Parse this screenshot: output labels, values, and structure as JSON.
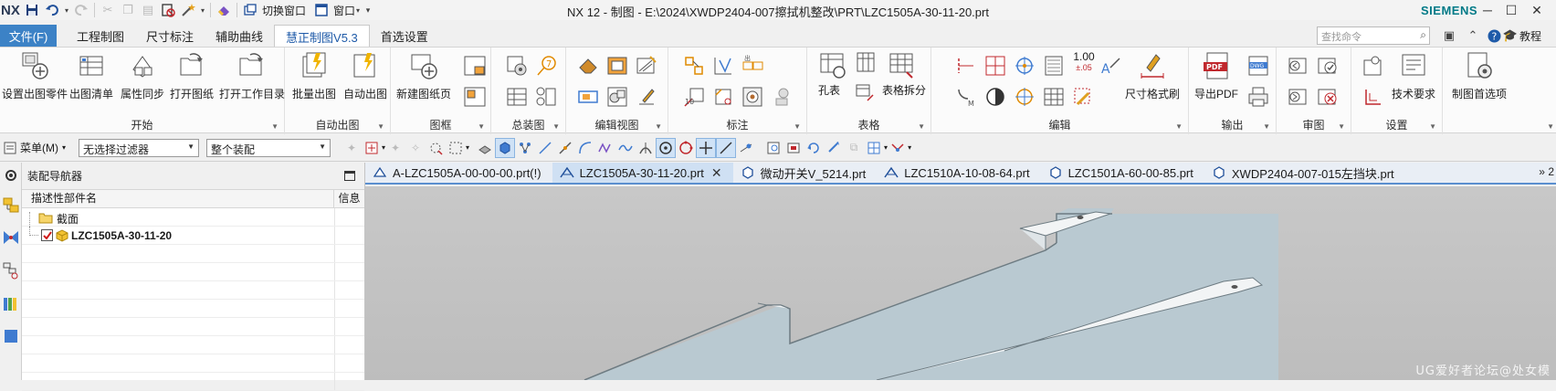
{
  "titlebar": {
    "logo": "NX",
    "quick_access": [
      "save-icon",
      "undo-icon",
      "redo-icon",
      "cut-icon",
      "copy-icon",
      "paste-icon",
      "delete-icon",
      "magic-wand-icon",
      "eraser-icon"
    ],
    "switch_window": "切换窗口",
    "window_menu": "窗口",
    "title": "NX 12 - 制图 - E:\\2024\\XWDP2404-007擦拭机整改\\PRT\\LZC1505A-30-11-20.prt",
    "brand": "SIEMENS"
  },
  "menubar": {
    "file": "文件(F)",
    "tabs": [
      "工程制图",
      "尺寸标注",
      "辅助曲线",
      "慧正制图V5.3",
      "首选设置"
    ],
    "active_tab": "慧正制图V5.3",
    "search_placeholder": "查找命令",
    "tutorial": "教程"
  },
  "ribbon": {
    "groups": {
      "start": {
        "label": "开始",
        "buttons": [
          "设置出图零件",
          "出图清单",
          "属性同步",
          "打开图纸",
          "打开工作目录"
        ]
      },
      "auto": {
        "label": "自动出图",
        "buttons": [
          "批量出图",
          "自动出图"
        ]
      },
      "frame": {
        "label": "图框",
        "buttons": [
          "新建图纸页"
        ]
      },
      "assembly": {
        "label": "总装图"
      },
      "editview": {
        "label": "编辑视图"
      },
      "annotation": {
        "label": "标注"
      },
      "table": {
        "label": "表格",
        "buttons": [
          "孔表",
          "表格拆分"
        ]
      },
      "edit": {
        "label": "编辑",
        "buttons": [
          "尺寸格式刷"
        ],
        "tolerance_text": "1.00",
        "tolerance_sub": "±.05"
      },
      "output": {
        "label": "输出",
        "buttons": [
          "导出PDF"
        ]
      },
      "review": {
        "label": "审图"
      },
      "settings": {
        "label": "设置",
        "buttons": [
          "技术要求"
        ]
      },
      "prefs": {
        "buttons": [
          "制图首选项"
        ]
      }
    }
  },
  "toolrow": {
    "menu": "菜单(M)",
    "filter": "无选择过滤器",
    "scope": "整个装配"
  },
  "navigator": {
    "title": "装配导航器",
    "col_name": "描述性部件名",
    "col_info": "信息",
    "rows": [
      {
        "label": "截面"
      },
      {
        "label": "LZC1505A-30-11-20"
      }
    ]
  },
  "doctabs": [
    {
      "label": "A-LZC1505A-00-00-00.prt(!)",
      "icon": "assembly-icon"
    },
    {
      "label": "LZC1505A-30-11-20.prt",
      "icon": "drafting-icon",
      "active": true
    },
    {
      "label": "微动开关V_5214.prt",
      "icon": "part-icon"
    },
    {
      "label": "LZC1510A-10-08-64.prt",
      "icon": "drafting-icon"
    },
    {
      "label": "LZC1501A-60-00-85.prt",
      "icon": "part-icon"
    },
    {
      "label": "XWDP2404-007-015左挡块.prt",
      "icon": "part-icon"
    }
  ],
  "tab_more": "»",
  "tab_more_num": "2",
  "watermark": "UG爱好者论坛@处女模",
  "colors": {
    "accent": "#3c82c6",
    "brand": "#007a87",
    "viewport": "#c4c4c4"
  }
}
